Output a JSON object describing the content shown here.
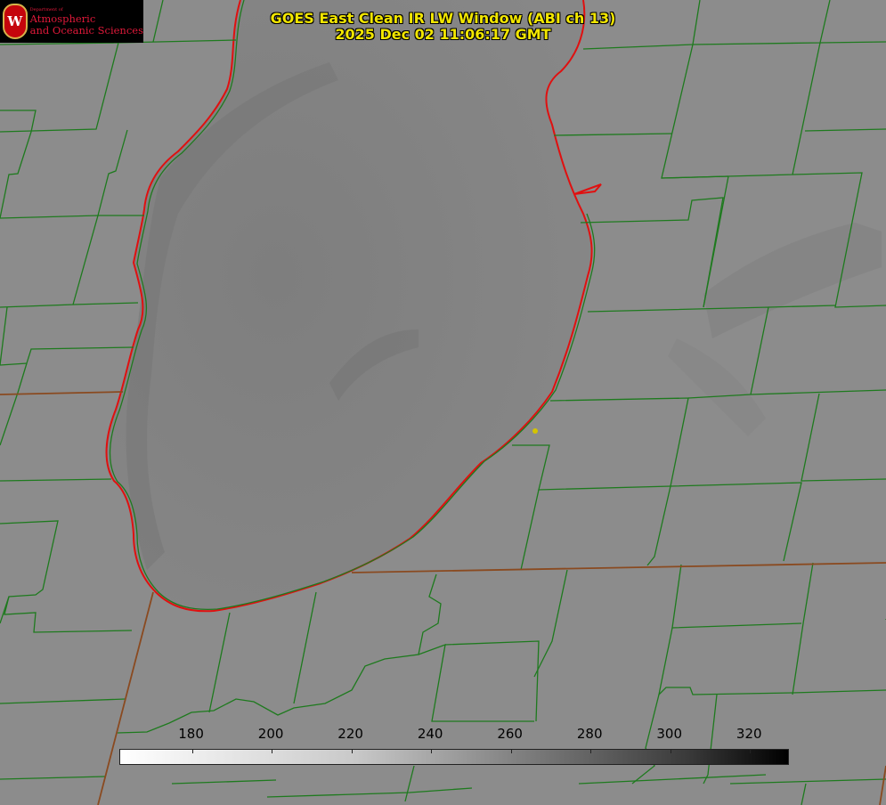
{
  "title": {
    "line1": "GOES East Clean IR LW Window (ABI ch 13)",
    "line2": "2025 Dec 02 11:06:17 GMT"
  },
  "logo": {
    "seal_letter": "W",
    "dept": "Department of",
    "line1": "Atmospheric",
    "line2": "and Oceanic Sciences"
  },
  "colorbar": {
    "ticks": [
      "180",
      "200",
      "220",
      "240",
      "260",
      "280",
      "300",
      "320"
    ],
    "tick_values": [
      180,
      200,
      220,
      240,
      260,
      280,
      300,
      320
    ],
    "range": [
      162,
      330
    ],
    "low_color": "#ffffff",
    "high_color": "#000000"
  },
  "colors": {
    "background_gray": "#8c8c8c",
    "county_lines": "#1e7a1e",
    "coastline": "#e01010",
    "title_text": "#f2e600",
    "marker": "#d4c400"
  }
}
